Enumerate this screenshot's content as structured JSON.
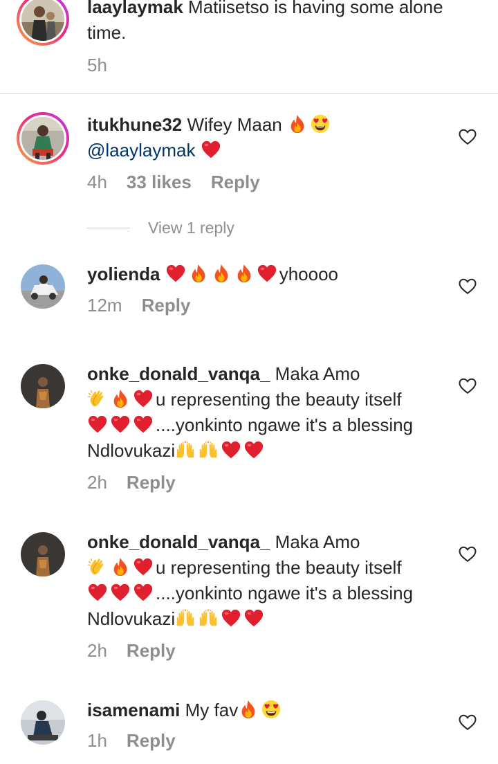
{
  "comments": [
    {
      "username": "laaylaymak",
      "text": "Matiisetso is having some alone time.",
      "time": "5h"
    },
    {
      "username": "itukhune32",
      "text": "Wifey Maan",
      "mention": "@laaylaymak",
      "time": "4h",
      "likes": "33 likes",
      "reply_label": "Reply",
      "view_replies": "View 1 reply"
    },
    {
      "username": "yolienda",
      "text_after": "yhoooo",
      "time": "12m",
      "reply_label": "Reply"
    },
    {
      "username": "onke_donald_vanqa_",
      "text_1": "Maka Amo",
      "text_2": "u representing the beauty itself",
      "text_3": "....yonkinto ngawe it's a blessing",
      "text_4": "Ndlovukazi",
      "time": "2h",
      "reply_label": "Reply"
    },
    {
      "username": "onke_donald_vanqa_",
      "text_1": "Maka Amo",
      "text_2": "u representing the beauty itself",
      "text_3": "....yonkinto ngawe it's a blessing",
      "text_4": "Ndlovukazi",
      "time": "2h",
      "reply_label": "Reply"
    },
    {
      "username": "isamenami",
      "text": "My fav",
      "time": "1h",
      "reply_label": "Reply"
    }
  ],
  "colors": {
    "text": "#262626",
    "muted": "#8e8e8e",
    "mention": "#003569",
    "heart_red": "#e0202e",
    "divider": "#dbdbdb"
  },
  "icons": {
    "like": "heart-outline-icon",
    "fire": "fire-emoji",
    "heart": "red-heart-emoji",
    "heart_eyes": "heart-eyes-emoji",
    "clap": "clapping-hands-emoji",
    "raised_hands": "raised-hands-emoji"
  }
}
